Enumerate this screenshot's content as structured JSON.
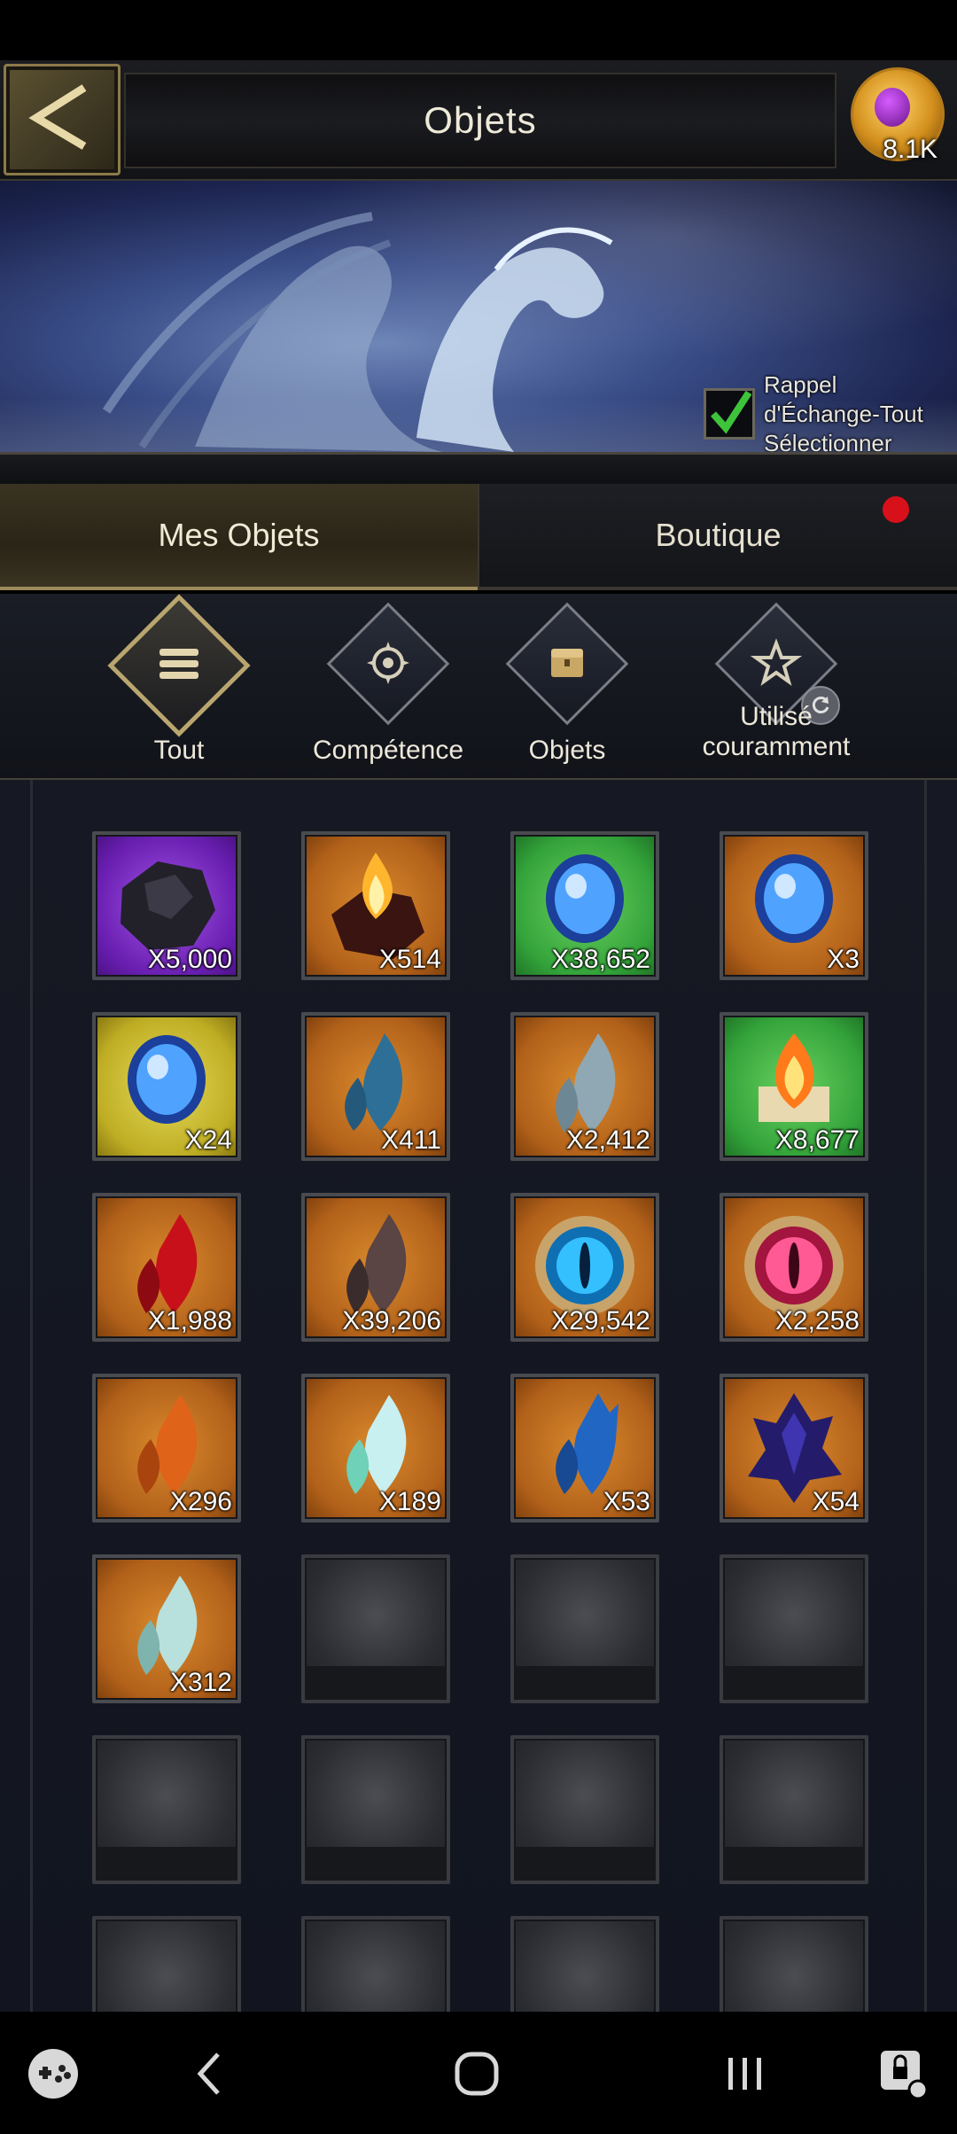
{
  "header": {
    "title": "Objets",
    "currency_amount": "8.1K"
  },
  "banner": {
    "reminder_text": "Rappel d'Échange-Tout Sélectionner",
    "reminder_checked": true
  },
  "tabs": [
    {
      "label": "Mes Objets",
      "active": true
    },
    {
      "label": "Boutique",
      "active": false,
      "notification": true
    }
  ],
  "categories": [
    {
      "label": "Tout",
      "icon": "list-icon",
      "active": true
    },
    {
      "label": "Compétence",
      "icon": "skill-icon",
      "active": false
    },
    {
      "label": "Objets",
      "icon": "chest-icon",
      "active": false
    },
    {
      "label": "Utilisé couramment",
      "icon": "star-icon",
      "active": false
    }
  ],
  "items": [
    {
      "icon": "coal-ore-icon",
      "rarity": "purple",
      "quantity": "X5,000"
    },
    {
      "icon": "fire-ore-icon",
      "rarity": "orange",
      "quantity": "X514"
    },
    {
      "icon": "blue-orb-icon",
      "rarity": "green",
      "quantity": "X38,652"
    },
    {
      "icon": "blue-orb-icon",
      "rarity": "orange",
      "quantity": "X3"
    },
    {
      "icon": "blue-orb-icon",
      "rarity": "yellow",
      "quantity": "X24"
    },
    {
      "icon": "blue-scale-icon",
      "rarity": "orange",
      "quantity": "X411"
    },
    {
      "icon": "silver-scale-icon",
      "rarity": "orange",
      "quantity": "X2,412"
    },
    {
      "icon": "fire-book-icon",
      "rarity": "green",
      "quantity": "X8,677"
    },
    {
      "icon": "red-scale-icon",
      "rarity": "orange",
      "quantity": "X1,988"
    },
    {
      "icon": "brown-scale-icon",
      "rarity": "orange",
      "quantity": "X39,206"
    },
    {
      "icon": "blue-dragon-eye-icon",
      "rarity": "orange",
      "quantity": "X29,542"
    },
    {
      "icon": "red-dragon-eye-icon",
      "rarity": "orange",
      "quantity": "X2,258"
    },
    {
      "icon": "orange-scale-icon",
      "rarity": "orange",
      "quantity": "X296"
    },
    {
      "icon": "crystal-scale-icon",
      "rarity": "orange",
      "quantity": "X189"
    },
    {
      "icon": "blue-spike-scale-icon",
      "rarity": "orange",
      "quantity": "X53"
    },
    {
      "icon": "dark-crystal-icon",
      "rarity": "orange",
      "quantity": "X54"
    },
    {
      "icon": "pale-scale-icon",
      "rarity": "orange",
      "quantity": "X312"
    }
  ],
  "colors": {
    "accent_gold": "#b9a56e",
    "notification_red": "#d8101a"
  }
}
